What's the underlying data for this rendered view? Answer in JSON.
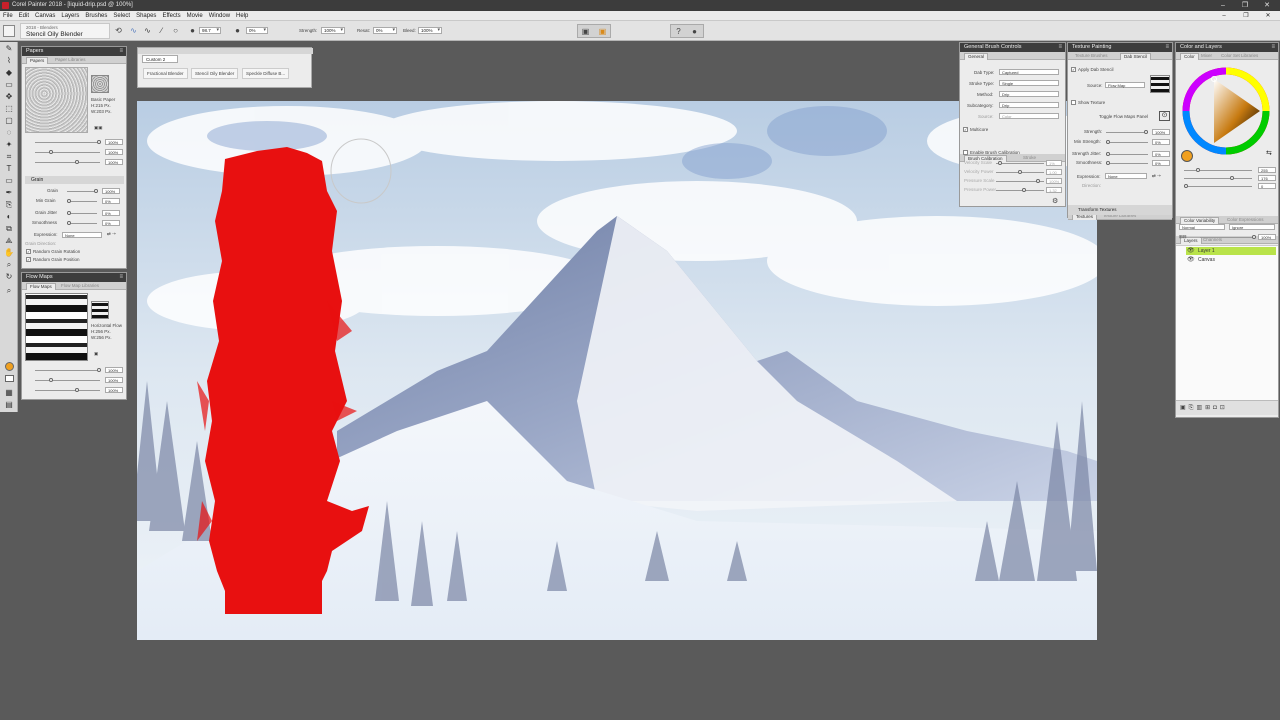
{
  "window": {
    "title": "Corel Painter 2018 - [liquid-drip.psd @ 100%]",
    "min": "–",
    "max": "❐",
    "close": "✕"
  },
  "menu": [
    "File",
    "Edit",
    "Canvas",
    "Layers",
    "Brushes",
    "Select",
    "Shapes",
    "Effects",
    "Movie",
    "Window",
    "Help"
  ],
  "property_bar": {
    "brush_category": "2018 - Blenders",
    "brush_variant": "Stencil Oily Blender",
    "size_value": "98.7",
    "opacity_value": "0%",
    "strength_label": "Strength:",
    "strength_value": "100%",
    "resat_label": "Resat:",
    "resat_value": "0%",
    "bleed_label": "Bleed:",
    "bleed_value": "100%"
  },
  "custom_palette": {
    "title": "Custom 2",
    "buttons": [
      "Fractional Blender",
      "Stencil Oily Blender",
      "Speckle Diffuse B..."
    ]
  },
  "papers_panel": {
    "title": "Papers",
    "tabs": [
      "Papers",
      "Paper Libraries"
    ],
    "paper_name": "Basic Paper",
    "paper_dims": "H:215 Px.",
    "paper_w": "W:203 Px.",
    "values": [
      "100%",
      "100%",
      "100%"
    ],
    "grain_title": "Grain",
    "grain_rows": [
      {
        "label": "Grain",
        "value": "100%"
      },
      {
        "label": "Min Grain",
        "value": "0%"
      },
      {
        "label": "Grain Jitter",
        "value": "0%"
      },
      {
        "label": "Smoothness",
        "value": "0%"
      }
    ],
    "expression_label": "Expression:",
    "expression_value": "None",
    "grain_direction_label": "Grain Direction:",
    "random_rotation": "Random Grain Rotation",
    "random_position": "Random Grain Position"
  },
  "flowmaps_panel": {
    "title": "Flow Maps",
    "tabs": [
      "Flow Maps",
      "Flow Map Libraries"
    ],
    "map_name": "Horizontal Flow",
    "map_h": "H:256 Px.",
    "map_w": "W:256 Px.",
    "values": [
      "100%",
      "100%",
      "100%"
    ]
  },
  "general_brush": {
    "title": "General Brush Controls",
    "tab": "General",
    "rows": [
      {
        "label": "Dab Type:",
        "value": "Captured"
      },
      {
        "label": "Stroke Type:",
        "value": "Single"
      },
      {
        "label": "Method:",
        "value": "Drip"
      },
      {
        "label": "Subcategory:",
        "value": "Drip"
      },
      {
        "label": "Source:",
        "value": "Color"
      }
    ],
    "multicore": "Multicore",
    "calibration_tab": "Brush Calibration",
    "calibration_tab2": "Stroke",
    "enable_calibration": "Enable Brush Calibration",
    "calib_rows": [
      {
        "label": "Velocity Scale",
        "value": "1%"
      },
      {
        "label": "Velocity Power",
        "value": "1.00"
      },
      {
        "label": "Pressure Scale",
        "value": "100%"
      },
      {
        "label": "Pressure Power",
        "value": "1.32"
      }
    ]
  },
  "texture_painting": {
    "title": "Texture Painting",
    "tabs": [
      "Texture Brushes",
      "Dab Stencil"
    ],
    "apply_dab": "Apply Dab Stencil",
    "source_label": "Source:",
    "source_value": "Flow Map",
    "show_texture": "Show Texture",
    "toggle_label": "Toggle Flow Maps Panel",
    "rows": [
      {
        "label": "Strength:",
        "value": "100%"
      },
      {
        "label": "Min Strength:",
        "value": "0%"
      },
      {
        "label": "Strength Jitter:",
        "value": "0%"
      },
      {
        "label": "Smoothness:",
        "value": "0%"
      }
    ],
    "expression_label": "Expression:",
    "expression_value": "None",
    "direction_label": "Direction:",
    "sections": [
      "Textures",
      "Texture Libraries",
      "Transform Textures"
    ]
  },
  "color_layers": {
    "title": "Color and Layers",
    "tabs": [
      "Color",
      "Mixer",
      "Color Set Libraries"
    ],
    "hsv": [
      "255",
      "176",
      "0"
    ],
    "sections": [
      "Color Variability",
      "Color Expressions"
    ],
    "layers_tabs": [
      "Layers",
      "Channels"
    ],
    "composite": "Normal",
    "preserve": "Ignore",
    "opacity": "100%",
    "layers": [
      "Layer 1",
      "Canvas"
    ],
    "accent": "#b0e24a"
  },
  "colors": {
    "paint_red": "#e81010",
    "selected_layer": "#b9e34a",
    "current_color": "#f0a020"
  }
}
